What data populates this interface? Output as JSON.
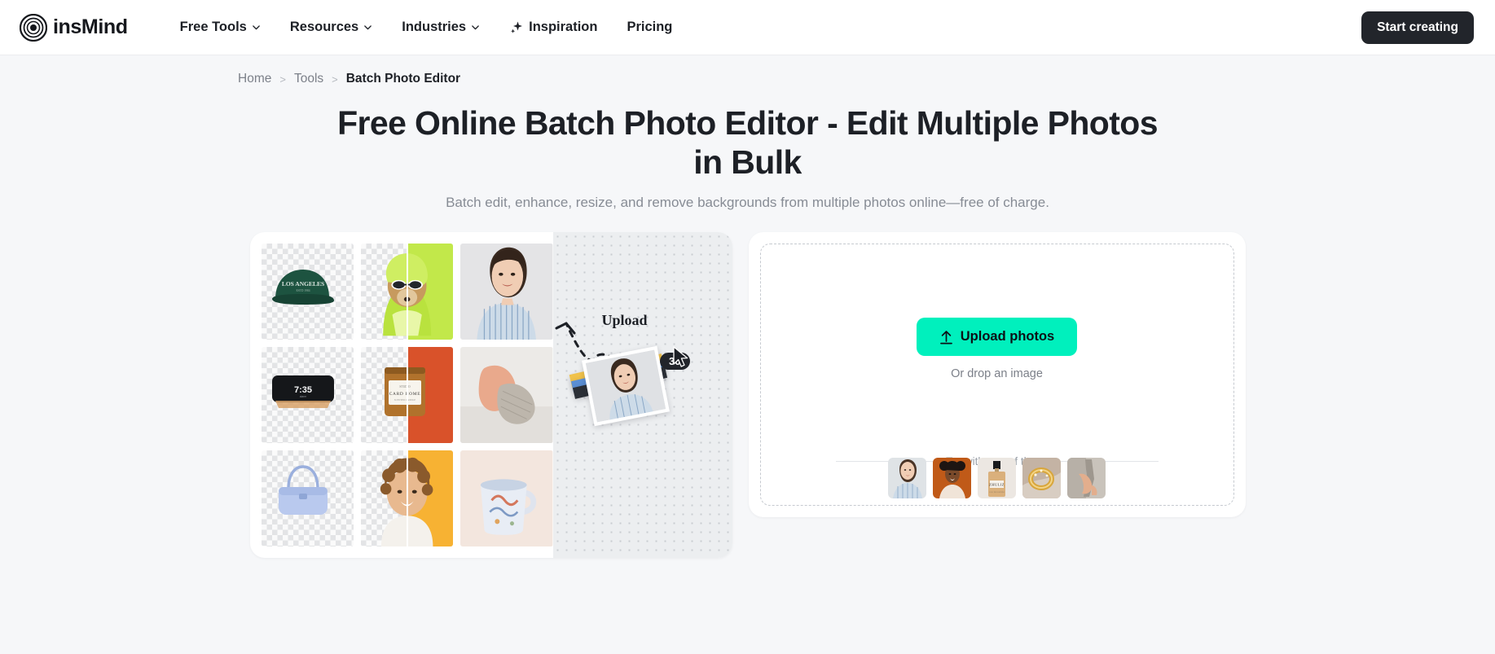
{
  "header": {
    "logo_text": "insMind",
    "logo_icon": "concentric-circles-logo",
    "nav": [
      {
        "label": "Free Tools",
        "icon": "chevron-down-icon",
        "has_chevron": true,
        "has_spark": false
      },
      {
        "label": "Resources",
        "icon": "chevron-down-icon",
        "has_chevron": true,
        "has_spark": false
      },
      {
        "label": "Industries",
        "icon": "chevron-down-icon",
        "has_chevron": true,
        "has_spark": false
      },
      {
        "label": "Inspiration",
        "icon": "sparkle-icon",
        "has_chevron": false,
        "has_spark": true
      },
      {
        "label": "Pricing",
        "icon": "",
        "has_chevron": false,
        "has_spark": false
      }
    ],
    "cta_label": "Start creating"
  },
  "breadcrumb": {
    "home": "Home",
    "tools": "Tools",
    "current": "Batch Photo Editor",
    "separator": ">"
  },
  "hero": {
    "title": "Free Online Batch Photo Editor - Edit Multiple Photos in Bulk",
    "subtitle": "Batch edit, enhance, resize, and remove backgrounds from multiple photos online—free of charge."
  },
  "showcase": {
    "grid": [
      {
        "name": "green-baseball-cap",
        "style": "cutout",
        "label": "LOS ANGELES"
      },
      {
        "name": "dog-in-green-scarf",
        "style": "split",
        "bg": "#c2e84a"
      },
      {
        "name": "smiling-woman-striped-shirt",
        "style": "photo",
        "bg": "#e4e4e6"
      },
      {
        "name": "black-alarm-clock",
        "style": "cutout",
        "label": "7:35"
      },
      {
        "name": "amber-candle-jar",
        "style": "split",
        "bg": "#d9522a"
      },
      {
        "name": "knit-shoes-product",
        "style": "photo",
        "bg": "#eceae7"
      },
      {
        "name": "blue-handbag",
        "style": "cutout",
        "label": ""
      },
      {
        "name": "curly-haired-child",
        "style": "split",
        "bg": "#f7b233"
      },
      {
        "name": "patterned-coffee-mug",
        "style": "photo",
        "bg": "#f3e6de"
      }
    ],
    "upload_label": "Upload",
    "badge_count": "30",
    "arrow_icon": "dashed-curved-arrow-icon",
    "cursor_icon": "mouse-pointer-icon"
  },
  "uploader": {
    "upload_button_label": "Upload photos",
    "upload_icon": "upload-arrow-icon",
    "drop_hint": "Or drop an image",
    "try_label": "Try with one of these",
    "samples": [
      {
        "name": "sample-woman-striped-shirt",
        "bg": "#dfe3e6"
      },
      {
        "name": "sample-woman-orange-bg",
        "bg": "#c05a18"
      },
      {
        "name": "sample-perfume-bottle",
        "bg": "#ece7e2"
      },
      {
        "name": "sample-gold-ring",
        "bg": "#c4b3a4"
      },
      {
        "name": "sample-legs-grey-bg",
        "bg": "#c9c3bb"
      }
    ]
  },
  "colors": {
    "accent_green": "#00f0bd",
    "dark": "#22252b",
    "page_bg": "#f6f7f9"
  }
}
